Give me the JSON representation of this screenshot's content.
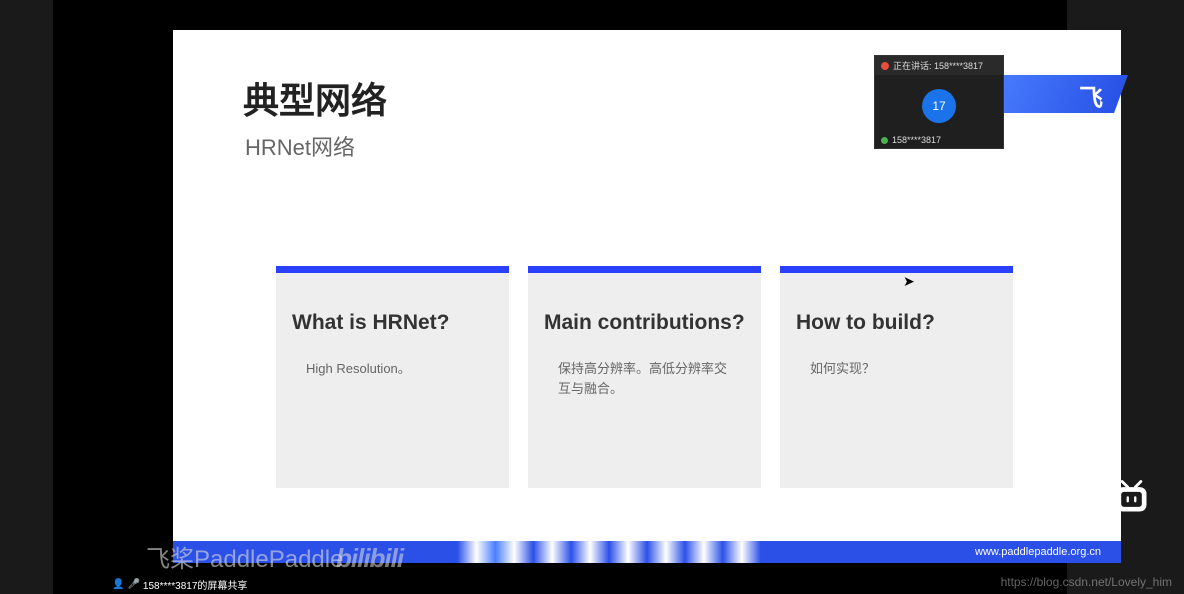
{
  "slide": {
    "title": "典型网络",
    "subtitle": "HRNet网络",
    "logo_text": "飞",
    "footer_url": "www.paddlepaddle.org.cn",
    "cards": [
      {
        "title": "What is HRNet?",
        "body": "High Resolution。"
      },
      {
        "title": "Main contributions?",
        "body": "保持高分辨率。高低分辨率交互与融合。"
      },
      {
        "title": "How to build?",
        "body": "如何实现？"
      }
    ]
  },
  "meeting": {
    "speaking_label": "正在讲话: 158****3817",
    "avatar_text": "17",
    "participant_name": "158****3817"
  },
  "watermarks": {
    "paddle": "飞桨PaddlePaddle",
    "bilibili": "bilibili",
    "csdn": "https://blog.csdn.net/Lovely_him"
  },
  "status": {
    "sharing": "158****3817的屏幕共享"
  }
}
